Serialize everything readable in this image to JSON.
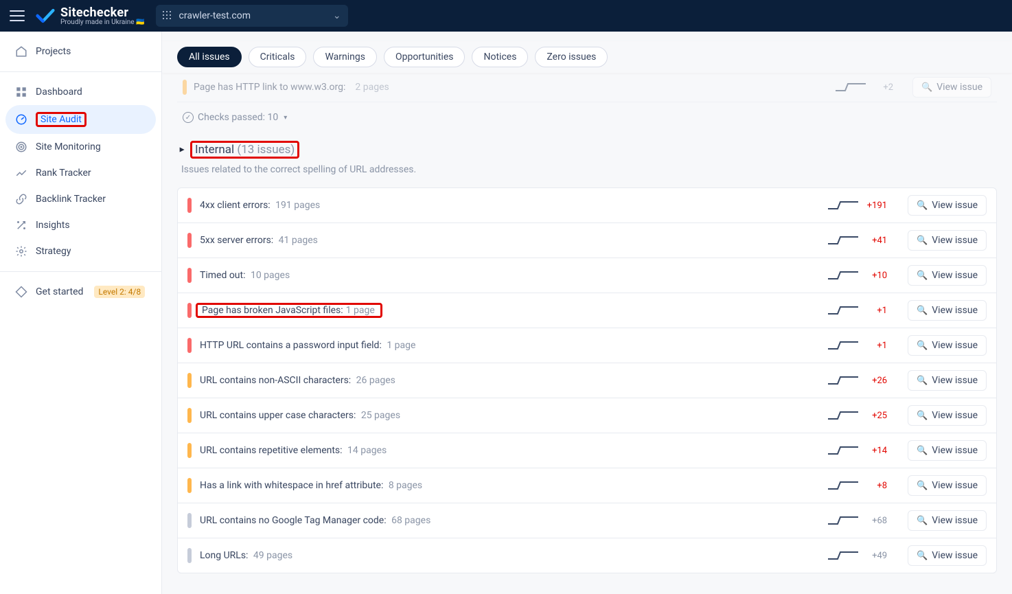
{
  "brand": {
    "name": "Sitechecker",
    "sub": "Proudly made in Ukraine 🇺🇦"
  },
  "site_selector": {
    "domain": "crawler-test.com"
  },
  "sidebar": {
    "projects": "Projects",
    "nav": [
      {
        "key": "dashboard",
        "label": "Dashboard"
      },
      {
        "key": "site-audit",
        "label": "Site Audit"
      },
      {
        "key": "site-monitoring",
        "label": "Site Monitoring"
      },
      {
        "key": "rank-tracker",
        "label": "Rank Tracker"
      },
      {
        "key": "backlink-tracker",
        "label": "Backlink Tracker"
      },
      {
        "key": "insights",
        "label": "Insights"
      },
      {
        "key": "strategy",
        "label": "Strategy"
      }
    ],
    "get_started": {
      "label": "Get started",
      "badge": "Level 2: 4/8"
    }
  },
  "pills": {
    "all": "All issues",
    "criticals": "Criticals",
    "warnings": "Warnings",
    "opportunities": "Opportunities",
    "notices": "Notices",
    "zero": "Zero issues"
  },
  "ghost_row": {
    "title": "Page has HTTP link to www.w3.org:",
    "pages": "2 pages",
    "delta": "+2",
    "view": "View issue"
  },
  "checks_passed": "Checks passed: 10",
  "group": {
    "name": "Internal",
    "count": "(13 issues)",
    "desc": "Issues related to the correct spelling of URL addresses."
  },
  "issues": [
    {
      "sev": "critical",
      "title": "4xx client errors:",
      "pages": "191 pages",
      "delta": "+191",
      "delta_cls": "pos",
      "highlight": false
    },
    {
      "sev": "critical",
      "title": "5xx server errors:",
      "pages": "41 pages",
      "delta": "+41",
      "delta_cls": "pos",
      "highlight": false
    },
    {
      "sev": "critical",
      "title": "Timed out:",
      "pages": "10 pages",
      "delta": "+10",
      "delta_cls": "pos",
      "highlight": false
    },
    {
      "sev": "critical",
      "title": "Page has broken JavaScript files:",
      "pages": "1 page",
      "delta": "+1",
      "delta_cls": "pos",
      "highlight": true
    },
    {
      "sev": "critical",
      "title": "HTTP URL contains a password input field:",
      "pages": "1 page",
      "delta": "+1",
      "delta_cls": "pos",
      "highlight": false
    },
    {
      "sev": "warning",
      "title": "URL contains non-ASCII characters:",
      "pages": "26 pages",
      "delta": "+26",
      "delta_cls": "pos",
      "highlight": false
    },
    {
      "sev": "warning",
      "title": "URL contains upper case characters:",
      "pages": "25 pages",
      "delta": "+25",
      "delta_cls": "pos",
      "highlight": false
    },
    {
      "sev": "warning",
      "title": "URL contains repetitive elements:",
      "pages": "14 pages",
      "delta": "+14",
      "delta_cls": "pos",
      "highlight": false
    },
    {
      "sev": "warning",
      "title": "Has a link with whitespace in href attribute:",
      "pages": "8 pages",
      "delta": "+8",
      "delta_cls": "pos",
      "highlight": false
    },
    {
      "sev": "gray",
      "title": "URL contains no Google Tag Manager code:",
      "pages": "68 pages",
      "delta": "+68",
      "delta_cls": "neg",
      "highlight": false
    },
    {
      "sev": "gray",
      "title": "Long URLs:",
      "pages": "49 pages",
      "delta": "+49",
      "delta_cls": "neg",
      "highlight": false
    }
  ],
  "labels": {
    "view_issue": "View issue"
  }
}
